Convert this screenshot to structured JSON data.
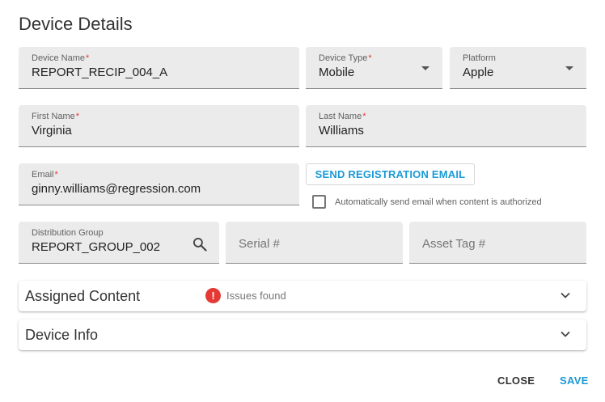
{
  "dialog": {
    "title": "Device Details"
  },
  "fields": {
    "device_name": {
      "label": "Device Name",
      "value": "REPORT_RECIP_004_A"
    },
    "device_type": {
      "label": "Device Type",
      "value": "Mobile"
    },
    "platform": {
      "label": "Platform",
      "value": "Apple"
    },
    "first_name": {
      "label": "First Name",
      "value": "Virginia"
    },
    "last_name": {
      "label": "Last Name",
      "value": "Williams"
    },
    "email": {
      "label": "Email",
      "value": "ginny.williams@regression.com"
    },
    "distribution_group": {
      "label": "Distribution Group",
      "value": "REPORT_GROUP_002"
    },
    "serial": {
      "placeholder": "Serial #"
    },
    "asset_tag": {
      "placeholder": "Asset Tag #"
    }
  },
  "required_marker": "*",
  "registration": {
    "button_label": "SEND REGISTRATION EMAIL",
    "auto_send_label": "Automatically send email when content is authorized",
    "auto_send_checked": false
  },
  "panels": {
    "assigned_content": {
      "title": "Assigned Content",
      "issue_icon": "!",
      "issue_text": "Issues found"
    },
    "device_info": {
      "title": "Device Info"
    }
  },
  "actions": {
    "close": "CLOSE",
    "save": "SAVE"
  },
  "colors": {
    "accent": "#1a9ad6",
    "required": "#e53935",
    "error": "#e53935"
  },
  "icons": {
    "search": "search-icon",
    "dropdown": "caret-down-icon",
    "expand": "chevron-down-icon",
    "issue": "error-icon"
  }
}
